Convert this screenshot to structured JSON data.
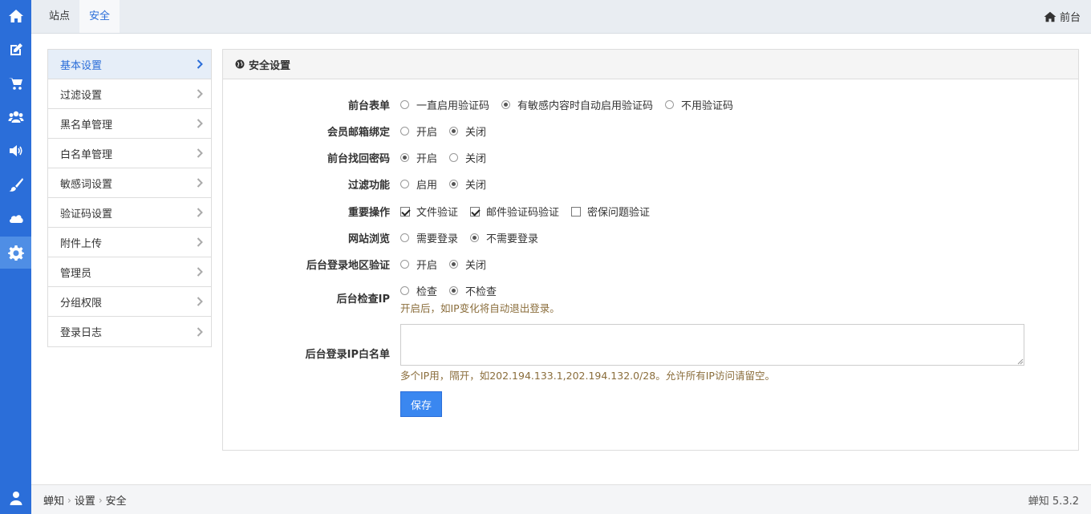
{
  "sidebar_icons": [
    "home-icon",
    "edit-icon",
    "cart-icon",
    "users-icon",
    "volume-icon",
    "brush-icon",
    "cloud-icon",
    "gear-icon",
    "user-icon"
  ],
  "topbar": {
    "tabs": [
      {
        "label": "站点",
        "active": false
      },
      {
        "label": "安全",
        "active": true
      }
    ],
    "front_link": "前台"
  },
  "menu": {
    "items": [
      {
        "label": "基本设置",
        "active": true
      },
      {
        "label": "过滤设置"
      },
      {
        "label": "黑名单管理"
      },
      {
        "label": "白名单管理"
      },
      {
        "label": "敏感词设置"
      },
      {
        "label": "验证码设置"
      },
      {
        "label": "附件上传"
      },
      {
        "label": "管理员"
      },
      {
        "label": "分组权限"
      },
      {
        "label": "登录日志"
      }
    ]
  },
  "panel": {
    "title": "安全设置",
    "rows": [
      {
        "label": "前台表单",
        "type": "radio",
        "options": [
          "一直启用验证码",
          "有敏感内容时自动启用验证码",
          "不用验证码"
        ],
        "selected": 1
      },
      {
        "label": "会员邮箱绑定",
        "type": "radio",
        "options": [
          "开启",
          "关闭"
        ],
        "selected": 1
      },
      {
        "label": "前台找回密码",
        "type": "radio",
        "options": [
          "开启",
          "关闭"
        ],
        "selected": 0
      },
      {
        "label": "过滤功能",
        "type": "radio",
        "options": [
          "启用",
          "关闭"
        ],
        "selected": 1
      },
      {
        "label": "重要操作",
        "type": "checkbox",
        "options": [
          "文件验证",
          "邮件验证码验证",
          "密保问题验证"
        ],
        "checked": [
          true,
          true,
          false
        ]
      },
      {
        "label": "网站浏览",
        "type": "radio",
        "options": [
          "需要登录",
          "不需要登录"
        ],
        "selected": 1
      },
      {
        "label": "后台登录地区验证",
        "type": "radio",
        "options": [
          "开启",
          "关闭"
        ],
        "selected": 1
      },
      {
        "label": "后台检查IP",
        "type": "radio",
        "options": [
          "检查",
          "不检查"
        ],
        "selected": 1,
        "help": "开启后，如IP变化将自动退出登录。"
      }
    ],
    "whitelist": {
      "label": "后台登录IP白名单",
      "value": "",
      "help": "多个IP用，隔开，如202.194.133.1,202.194.132.0/28。允许所有IP访问请留空。"
    },
    "save_label": "保存"
  },
  "footer": {
    "breadcrumb": [
      "蝉知",
      "设置",
      "安全"
    ],
    "version": "蝉知 5.3.2"
  }
}
